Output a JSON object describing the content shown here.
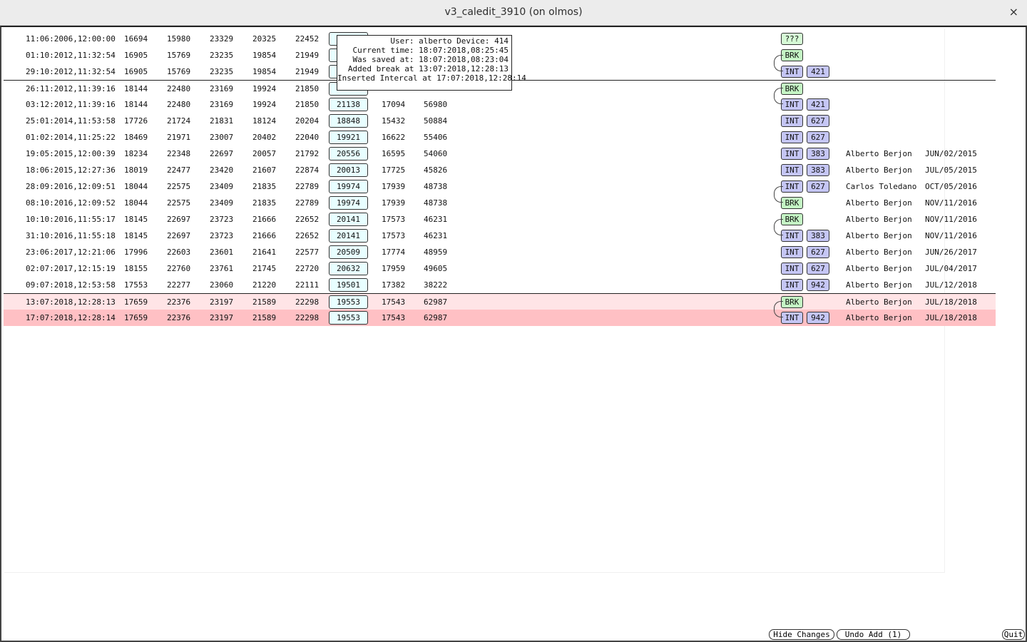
{
  "window": {
    "title": "v3_caledit_3910 (on olmos)",
    "close_glyph": "×"
  },
  "rows": [
    {
      "date": "11:06:2006,12:00:00",
      "a": "16694",
      "b": "15980",
      "c": "23329",
      "d": "20325",
      "e": "22452",
      "box": "21044",
      "f": "",
      "g": "",
      "type": "???",
      "num": "",
      "name": "",
      "date2": ""
    },
    {
      "date": "01:10:2012,11:32:54",
      "a": "16905",
      "b": "15769",
      "c": "23235",
      "d": "19854",
      "e": "21949",
      "box": "",
      "f": "",
      "g": "",
      "type": "BRK",
      "num": "",
      "name": "",
      "date2": ""
    },
    {
      "date": "29:10:2012,11:32:54",
      "a": "16905",
      "b": "15769",
      "c": "23235",
      "d": "19854",
      "e": "21949",
      "box": "",
      "f": "",
      "g": "",
      "type": "INT",
      "num": "421",
      "name": "",
      "date2": ""
    },
    {
      "date": "26:11:2012,11:39:16",
      "a": "18144",
      "b": "22480",
      "c": "23169",
      "d": "19924",
      "e": "21850",
      "box": "",
      "f": "",
      "g": "",
      "type": "BRK",
      "num": "",
      "name": "",
      "date2": ""
    },
    {
      "date": "03:12:2012,11:39:16",
      "a": "18144",
      "b": "22480",
      "c": "23169",
      "d": "19924",
      "e": "21850",
      "box": "21138",
      "f": "17094",
      "g": "56980",
      "type": "INT",
      "num": "421",
      "name": "",
      "date2": ""
    },
    {
      "date": "25:01:2014,11:53:58",
      "a": "17726",
      "b": "21724",
      "c": "21831",
      "d": "18124",
      "e": "20204",
      "box": "18848",
      "f": "15432",
      "g": "50884",
      "type": "INT",
      "num": "627",
      "name": "",
      "date2": ""
    },
    {
      "date": "01:02:2014,11:25:22",
      "a": "18469",
      "b": "21971",
      "c": "23007",
      "d": "20402",
      "e": "22040",
      "box": "19921",
      "f": "16622",
      "g": "55406",
      "type": "INT",
      "num": "627",
      "name": "",
      "date2": ""
    },
    {
      "date": "19:05:2015,12:00:39",
      "a": "18234",
      "b": "22348",
      "c": "22697",
      "d": "20057",
      "e": "21792",
      "box": "20556",
      "f": "16595",
      "g": "54060",
      "type": "INT",
      "num": "383",
      "name": "Alberto Berjon",
      "date2": "JUN/02/2015"
    },
    {
      "date": "18:06:2015,12:27:36",
      "a": "18019",
      "b": "22477",
      "c": "23420",
      "d": "21607",
      "e": "22874",
      "box": "20013",
      "f": "17725",
      "g": "45826",
      "type": "INT",
      "num": "383",
      "name": "Alberto Berjon",
      "date2": "JUL/05/2015"
    },
    {
      "date": "28:09:2016,12:09:51",
      "a": "18044",
      "b": "22575",
      "c": "23409",
      "d": "21835",
      "e": "22789",
      "box": "19974",
      "f": "17939",
      "g": "48738",
      "type": "INT",
      "num": "627",
      "name": "Carlos Toledano",
      "date2": "OCT/05/2016"
    },
    {
      "date": "08:10:2016,12:09:52",
      "a": "18044",
      "b": "22575",
      "c": "23409",
      "d": "21835",
      "e": "22789",
      "box": "19974",
      "f": "17939",
      "g": "48738",
      "type": "BRK",
      "num": "",
      "name": "Alberto Berjon",
      "date2": "NOV/11/2016"
    },
    {
      "date": "10:10:2016,11:55:17",
      "a": "18145",
      "b": "22697",
      "c": "23723",
      "d": "21666",
      "e": "22652",
      "box": "20141",
      "f": "17573",
      "g": "46231",
      "type": "BRK",
      "num": "",
      "name": "Alberto Berjon",
      "date2": "NOV/11/2016"
    },
    {
      "date": "31:10:2016,11:55:18",
      "a": "18145",
      "b": "22697",
      "c": "23723",
      "d": "21666",
      "e": "22652",
      "box": "20141",
      "f": "17573",
      "g": "46231",
      "type": "INT",
      "num": "383",
      "name": "Alberto Berjon",
      "date2": "NOV/11/2016"
    },
    {
      "date": "23:06:2017,12:21:06",
      "a": "17996",
      "b": "22603",
      "c": "23601",
      "d": "21641",
      "e": "22577",
      "box": "20509",
      "f": "17774",
      "g": "48959",
      "type": "INT",
      "num": "627",
      "name": "Alberto Berjon",
      "date2": "JUN/26/2017"
    },
    {
      "date": "02:07:2017,12:15:19",
      "a": "18155",
      "b": "22760",
      "c": "23761",
      "d": "21745",
      "e": "22720",
      "box": "20632",
      "f": "17959",
      "g": "49605",
      "type": "INT",
      "num": "627",
      "name": "Alberto Berjon",
      "date2": "JUL/04/2017"
    },
    {
      "date": "09:07:2018,12:53:58",
      "a": "17553",
      "b": "22277",
      "c": "23060",
      "d": "21220",
      "e": "22111",
      "box": "19501",
      "f": "17382",
      "g": "38222",
      "type": "INT",
      "num": "942",
      "name": "Alberto Berjon",
      "date2": "JUL/12/2018"
    },
    {
      "date": "13:07:2018,12:28:13",
      "a": "17659",
      "b": "22376",
      "c": "23197",
      "d": "21589",
      "e": "22298",
      "box": "19553",
      "f": "17543",
      "g": "62987",
      "type": "BRK",
      "num": "",
      "name": "Alberto Berjon",
      "date2": "JUL/18/2018"
    },
    {
      "date": "17:07:2018,12:28:14",
      "a": "17659",
      "b": "22376",
      "c": "23197",
      "d": "21589",
      "e": "22298",
      "box": "19553",
      "f": "17543",
      "g": "62987",
      "type": "INT",
      "num": "942",
      "name": "Alberto Berjon",
      "date2": "JUL/18/2018"
    }
  ],
  "tooltip": {
    "lines": [
      "User: alberto Device: 414",
      "Current time: 18:07:2018,08:25:45",
      "Was saved at: 18:07:2018,08:23:04",
      "Added break at 13:07:2018,12:28:13",
      "Inserted Intercal at 17:07:2018,12:28:14"
    ]
  },
  "buttons": {
    "hide_changes": "Hide Changes",
    "undo_add": "Undo Add (1)",
    "quit": "Quit"
  },
  "colors": {
    "int_tag": "#c5c6f5",
    "brk_tag": "#c5f5c5",
    "value_box": "#e8feff",
    "highlight_light": "#ffe4e6",
    "highlight_dark": "#ffc0c4"
  }
}
